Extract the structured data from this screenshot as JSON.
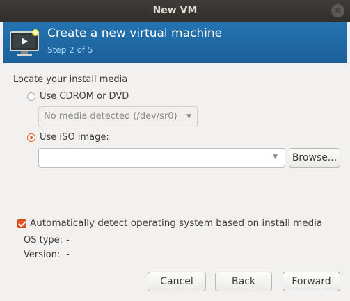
{
  "window": {
    "title": "New VM",
    "close_glyph": "×"
  },
  "header": {
    "title": "Create a new virtual machine",
    "step": "Step 2 of 5",
    "icon": "monitor-icon"
  },
  "install_media": {
    "heading": "Locate your install media",
    "cdrom_label": "Use CDROM or DVD",
    "cdrom_combo_value": "No media detected (/dev/sr0)",
    "iso_label": "Use ISO image:",
    "iso_value": "",
    "selected_option": "iso",
    "browse_label": "Browse..."
  },
  "os_detect": {
    "auto_label": "Automatically detect operating system based on install media",
    "auto_checked": true,
    "os_type_label": "OS type:",
    "os_type_value": "-",
    "version_label": "Version:",
    "version_value": "-"
  },
  "buttons": {
    "cancel": "Cancel",
    "back": "Back",
    "forward": "Forward"
  },
  "colors": {
    "accent": "#e95420",
    "banner": "#1f6aa5",
    "titlebar": "#3c3b37"
  }
}
